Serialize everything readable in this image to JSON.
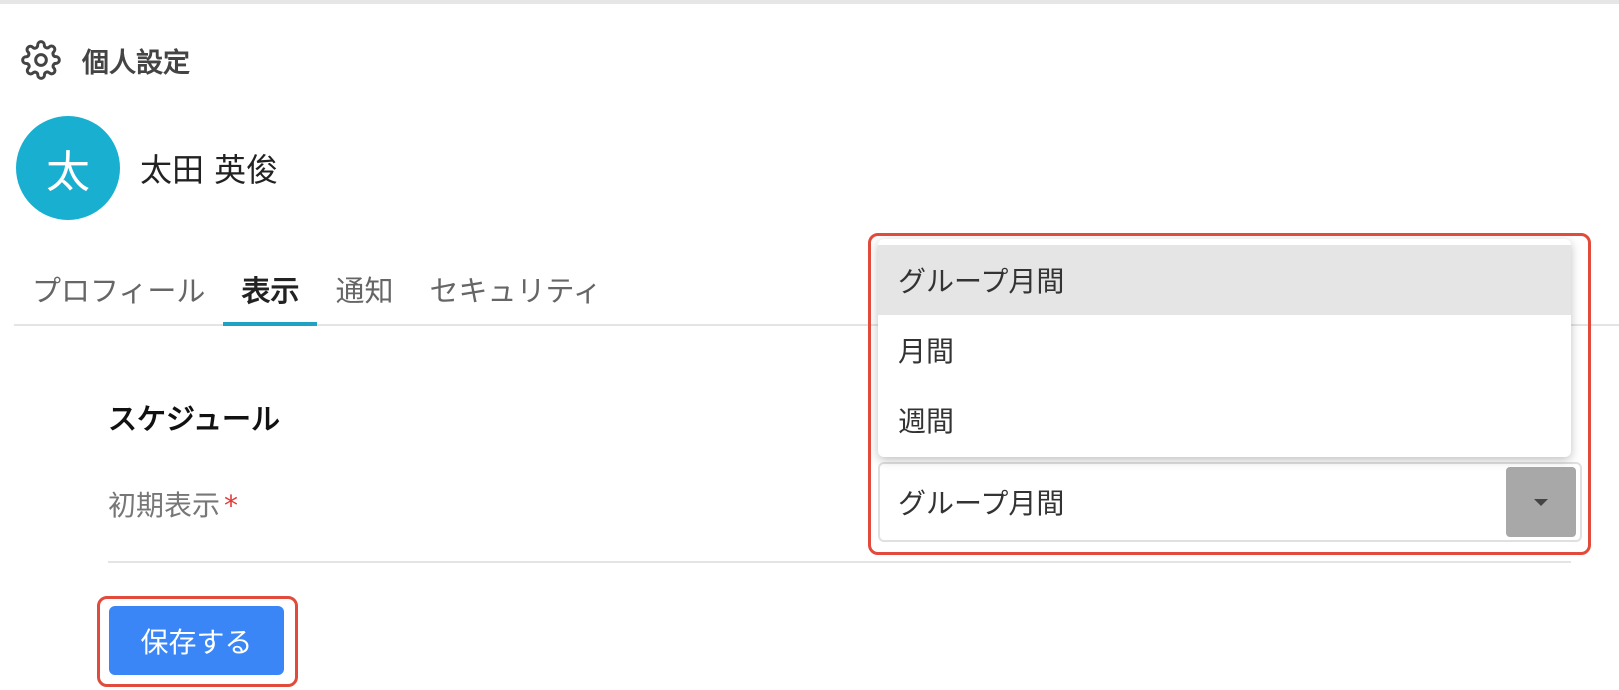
{
  "header": {
    "icon": "gear-icon",
    "title": "個人設定"
  },
  "user": {
    "avatar_initial": "太",
    "avatar_color": "#19afd1",
    "name": "太田 英俊"
  },
  "tabs": [
    {
      "label": "プロフィール",
      "active": false
    },
    {
      "label": "表示",
      "active": true
    },
    {
      "label": "通知",
      "active": false
    },
    {
      "label": "セキュリティ",
      "active": false
    }
  ],
  "section": {
    "title": "スケジュール"
  },
  "field": {
    "label": "初期表示",
    "required_mark": "*"
  },
  "select": {
    "value": "グループ月間",
    "options": [
      {
        "label": "グループ月間",
        "selected": true
      },
      {
        "label": "月間",
        "selected": false
      },
      {
        "label": "週間",
        "selected": false
      }
    ]
  },
  "actions": {
    "save_label": "保存する",
    "save_color": "#3b86f7"
  },
  "highlight_color": "#e24b3b"
}
